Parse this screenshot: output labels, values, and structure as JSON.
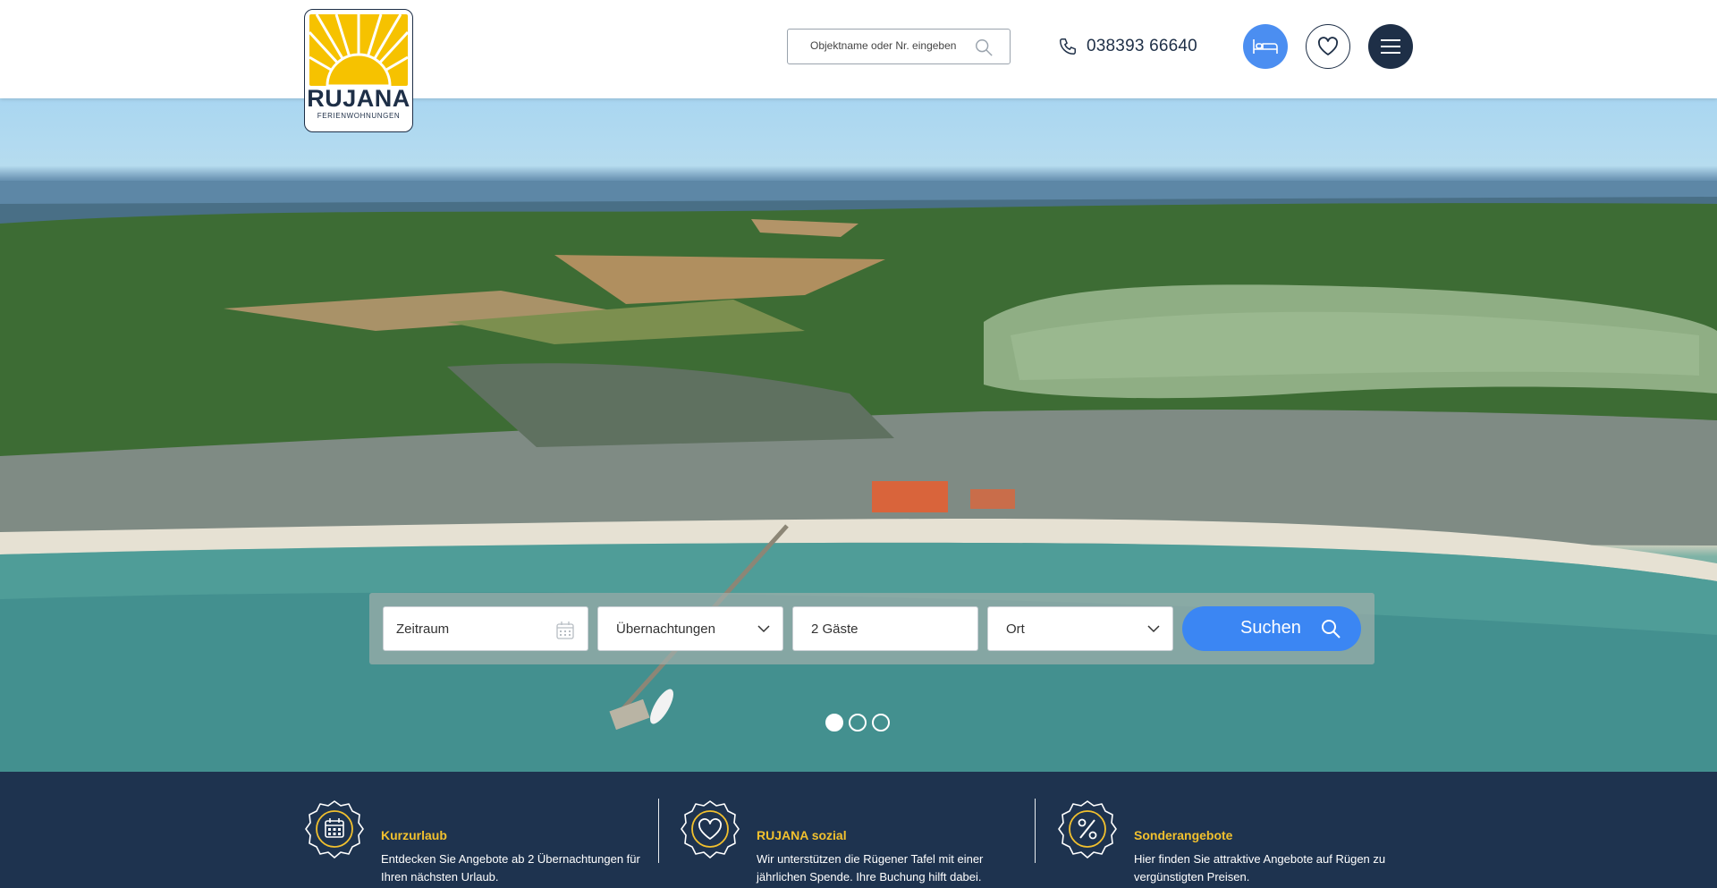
{
  "brand": {
    "name": "RUJANA",
    "tagline": "FERIENWOHNUNGEN",
    "navy": "#1e2f47",
    "yellow": "#f6c200",
    "blue": "#3b86f3"
  },
  "header": {
    "search": {
      "placeholder": "Objektname oder Nr. eingeben",
      "icon": "search-icon"
    },
    "phone": {
      "number": "038393 66640",
      "icon": "phone-icon"
    },
    "buttons": [
      {
        "name": "bed-button",
        "icon": "bed-icon"
      },
      {
        "name": "favorites-button",
        "icon": "heart-icon"
      },
      {
        "name": "menu-button",
        "icon": "hamburger-icon"
      }
    ]
  },
  "hero": {
    "search_form": {
      "date_label": "Zeitraum",
      "nights_label": "Übernachtungen",
      "guests_label": "2 Gäste",
      "place_label": "Ort",
      "submit_label": "Suchen"
    },
    "slides": {
      "count": 3,
      "active": 1
    }
  },
  "features": [
    {
      "title": "Kurzurlaub",
      "text": "Entdecken Sie Angebote ab 2 Übernachtungen für Ihren nächsten Urlaub.",
      "icon": "calendar-badge-icon"
    },
    {
      "title": "RUJANA sozial",
      "text": "Wir unterstützen die Rügener Tafel mit einer jährlichen Spende. Ihre Buchung hilft dabei.",
      "icon": "heart-badge-icon"
    },
    {
      "title": "Sonderangebote",
      "text": "Hier finden Sie attraktive Angebote auf Rügen zu vergünstigten Preisen.",
      "icon": "percent-badge-icon"
    }
  ]
}
